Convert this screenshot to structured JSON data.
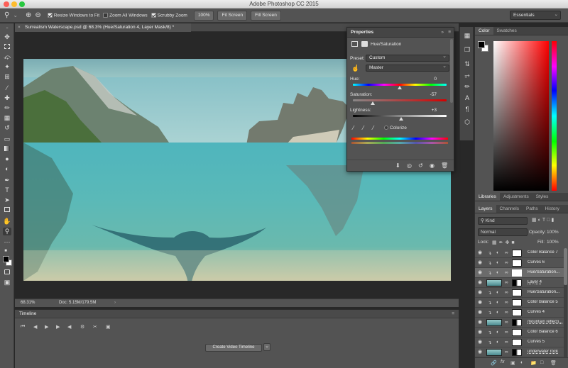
{
  "app": {
    "title": "Adobe Photoshop CC 2015"
  },
  "options_bar": {
    "resize_windows": "Resize Windows to Fit",
    "zoom_all": "Zoom All Windows",
    "scrubby": "Scrubby Zoom",
    "zoom_pct": "100%",
    "fit_screen": "Fit Screen",
    "fill_screen": "Fill Screen",
    "workspace": "Essentials"
  },
  "document": {
    "tab_title": "Surrealism Waterscape.psd @ 68.3% (Hue/Saturation 4, Layer Mask/8) *",
    "zoom": "68.31%",
    "doc_info": "Doc: 5.15M/179.5M"
  },
  "timeline": {
    "title": "Timeline",
    "create_button": "Create Video Timeline"
  },
  "properties": {
    "tab": "Properties",
    "adjustment": "Hue/Saturation",
    "preset_label": "Preset:",
    "preset_value": "Custom",
    "channel_value": "Master",
    "hue_label": "Hue:",
    "hue_value": "0",
    "saturation_label": "Saturation:",
    "saturation_value": "-57",
    "lightness_label": "Lightness:",
    "lightness_value": "+3",
    "colorize_label": "Colorize",
    "slider_levels": {
      "hue": 0.5,
      "saturation": 0.215,
      "lightness": 0.515
    }
  },
  "color_panel": {
    "tabs": [
      "Color",
      "Swatches"
    ],
    "foreground": "#000000",
    "background": "#ffffff"
  },
  "mid_tabs": [
    "Libraries",
    "Adjustments",
    "Styles"
  ],
  "layers_panel": {
    "tabs": [
      "Layers",
      "Channels",
      "Paths",
      "History"
    ],
    "filter": "Kind",
    "blend_mode": "Normal",
    "opacity_label": "Opacity:",
    "opacity_value": "100%",
    "lock_label": "Lock:",
    "fill_label": "Fill:",
    "fill_value": "100%",
    "layers": [
      {
        "name": "Color Balance 7",
        "type": "adj"
      },
      {
        "name": "Curves 6",
        "type": "adj"
      },
      {
        "name": "Hue/Saturation...",
        "type": "adj",
        "selected": true
      },
      {
        "name": "Layer 4",
        "type": "pixel"
      },
      {
        "name": "Hue/Saturation...",
        "type": "adj"
      },
      {
        "name": "Color Balance 5",
        "type": "adj"
      },
      {
        "name": "Curves 4",
        "type": "adj"
      },
      {
        "name": "mountain reflecti...",
        "type": "pixel"
      },
      {
        "name": "Color Balance 6",
        "type": "adj"
      },
      {
        "name": "Curves 5",
        "type": "adj"
      },
      {
        "name": "underwater rock",
        "type": "pixel"
      }
    ]
  }
}
